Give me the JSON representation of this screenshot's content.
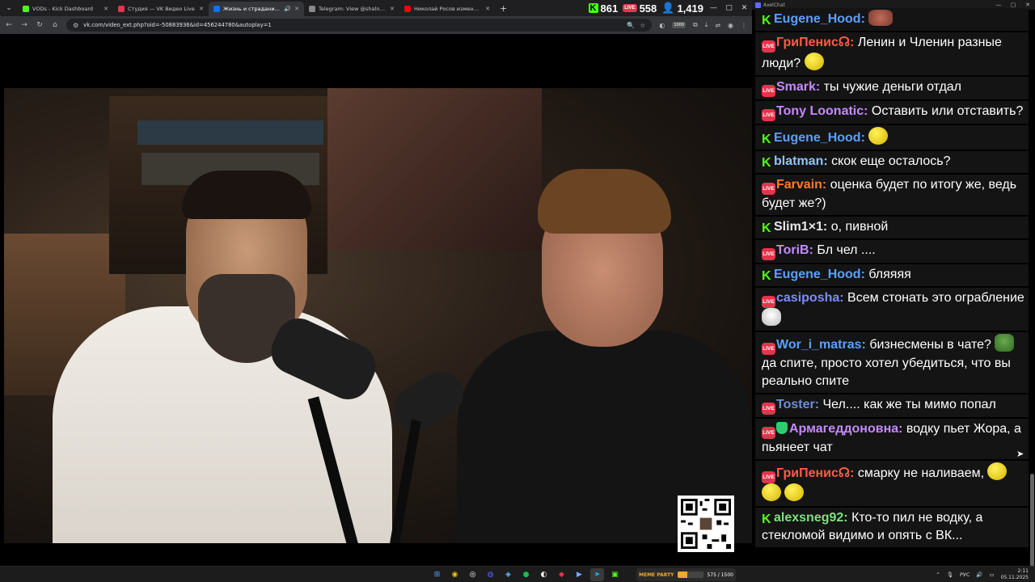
{
  "browser": {
    "tabs": [
      {
        "label": "VODs - Kick Dashboard",
        "color": "#53fc18"
      },
      {
        "label": "Студия — VK Видео Live",
        "color": "#e0364b"
      },
      {
        "label": "Жизнь и страдания Романа...",
        "color": "#0077ff",
        "active": true
      },
      {
        "label": "Telegram: View @shalnyak",
        "color": "#888888"
      },
      {
        "label": "Николай Росов изменит дома...",
        "color": "#ff0000"
      }
    ],
    "new_tab": "+",
    "stats": {
      "kick_viewers": "861",
      "live_viewers": "558",
      "total_viewers": "1,419"
    },
    "url": "vk.com/video_ext.php?oid=-50883936&id=456244780&autoplay=1",
    "extension_badge": "1000"
  },
  "chat": {
    "title": "AxelChat",
    "messages": [
      {
        "platform": "kick",
        "user": "Eugene_Hood:",
        "color": "#5aa0ff",
        "text": "",
        "emotes": [
          "face"
        ]
      },
      {
        "platform": "live",
        "user": "ГриПенис☊:",
        "color": "#ff5a4a",
        "text": "Ленин и Членин разные люди?",
        "emotes": [
          "yellow"
        ]
      },
      {
        "platform": "live",
        "user": "Smark:",
        "color": "#c48aff",
        "text": "ты чужие деньги отдал"
      },
      {
        "platform": "live",
        "user": "Tony Loonatic:",
        "color": "#c48aff",
        "text": "Оставить или отставить?"
      },
      {
        "platform": "kick",
        "user": "Eugene_Hood:",
        "color": "#5aa0ff",
        "text": "",
        "emotes": [
          "yellow"
        ]
      },
      {
        "platform": "kick",
        "user": "blatman:",
        "color": "#8ec5ff",
        "text": "скок еще осталось?"
      },
      {
        "platform": "live",
        "user": "Farvain:",
        "color": "#ff7a2f",
        "text": "оценка будет по итогу же, ведь будет же?)"
      },
      {
        "platform": "kick",
        "user": "Slim1×1:",
        "color": "#e8e8e8",
        "text": "о, пивной"
      },
      {
        "platform": "live",
        "user": "ToriB:",
        "color": "#c48aff",
        "text": "Бл чел ...."
      },
      {
        "platform": "kick",
        "user": "Eugene_Hood:",
        "color": "#5aa0ff",
        "text": "бляяяя"
      },
      {
        "platform": "live",
        "user": "casiposha:",
        "color": "#7b8cff",
        "text": "Всем стонать это ограбление",
        "emotes": [
          "joker"
        ]
      },
      {
        "platform": "live",
        "user": "Wor_i_matras:",
        "color": "#5aa0ff",
        "text": "бизнесмены в чате?",
        "text2": "да спите, просто хотел убедиться, что вы реально спите",
        "emotes": [
          "pepe"
        ]
      },
      {
        "platform": "live",
        "user": "Toster:",
        "color": "#6e8fd6",
        "text": "Чел.... как же ты мимо попал"
      },
      {
        "platform": "live",
        "user": "Армагеддоновна:",
        "color": "#c48aff",
        "text": "водку пьет Жора, а пьянеет чат",
        "shield": true
      },
      {
        "platform": "live",
        "user": "ГриПенис☊:",
        "color": "#ff5a4a",
        "text": "смарку не наливаем,",
        "emotes": [
          "yellow",
          "yellow",
          "yellow"
        ]
      },
      {
        "platform": "kick",
        "user": "alexsneg92:",
        "color": "#7ee07e",
        "text": "Кто-то пил не водку, а стекломой видимо и опять с ВК..."
      }
    ]
  },
  "taskbar": {
    "widget_label": "MEME PARTY",
    "widget_progress": "575 / 1500",
    "widget_fraction": 0.38,
    "lang": "РУС",
    "time": "2:11",
    "date": "05.11.2025"
  }
}
